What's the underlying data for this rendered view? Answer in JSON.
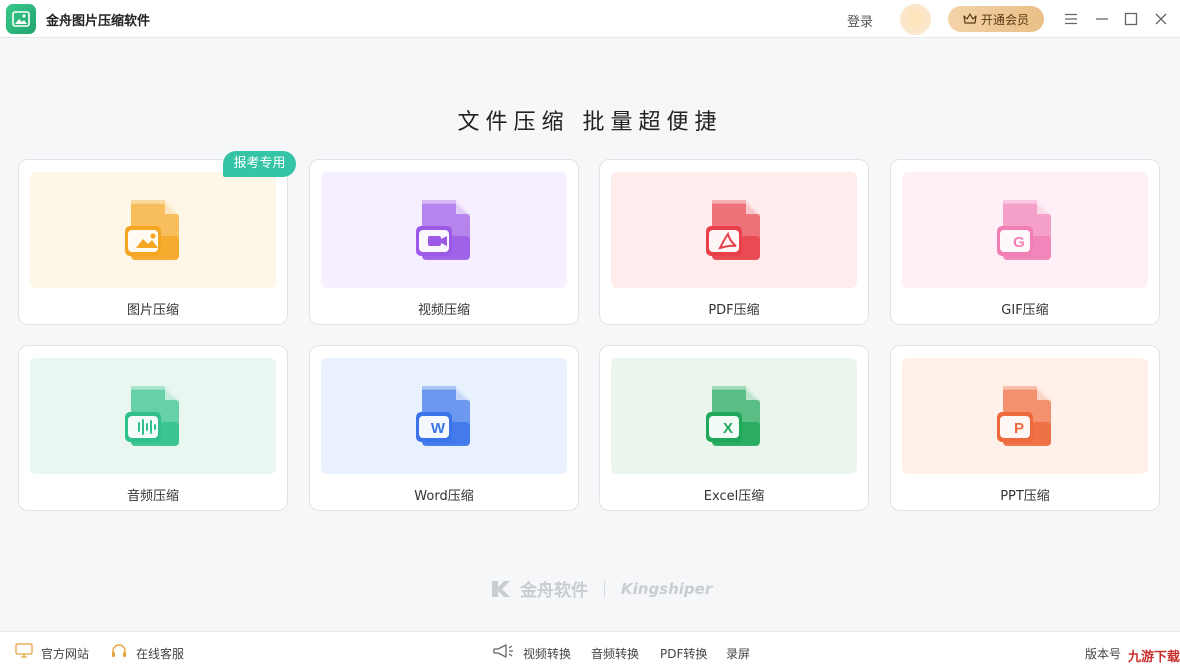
{
  "app": {
    "title": "金舟图片压缩软件"
  },
  "header": {
    "login_label": "登录",
    "vip_label": "开通会员"
  },
  "main": {
    "headline": "文件压缩  批量超便捷",
    "badge": "报考专用",
    "cards": [
      {
        "label": "图片压缩",
        "icon": "image-file-icon",
        "accent": "#f5a623",
        "bg": "#fef6e6"
      },
      {
        "label": "视频压缩",
        "icon": "video-file-icon",
        "accent": "#9b59e6",
        "bg": "#f6efff"
      },
      {
        "label": "PDF压缩",
        "icon": "pdf-file-icon",
        "accent": "#e8404a",
        "bg": "#ffeded"
      },
      {
        "label": "GIF压缩",
        "icon": "gif-file-icon",
        "accent": "#f17fb6",
        "bg": "#fff0f7"
      },
      {
        "label": "音频压缩",
        "icon": "audio-file-icon",
        "accent": "#2fc08b",
        "bg": "#eaf7f1"
      },
      {
        "label": "Word压缩",
        "icon": "word-file-icon",
        "accent": "#3a73ea",
        "bg": "#eaf1fe"
      },
      {
        "label": "Excel压缩",
        "icon": "excel-file-icon",
        "accent": "#1fa85a",
        "bg": "#eaf5ee"
      },
      {
        "label": "PPT压缩",
        "icon": "ppt-file-icon",
        "accent": "#ee6a3c",
        "bg": "#fff0ea"
      }
    ],
    "brand_cn": "金舟软件",
    "brand_en": "Kingshiper"
  },
  "footer": {
    "website": "官方网站",
    "service": "在线客服",
    "links": [
      "视频转换",
      "音频转换",
      "PDF转换",
      "录屏"
    ],
    "version": "版本号"
  },
  "watermark": "九游下载网"
}
